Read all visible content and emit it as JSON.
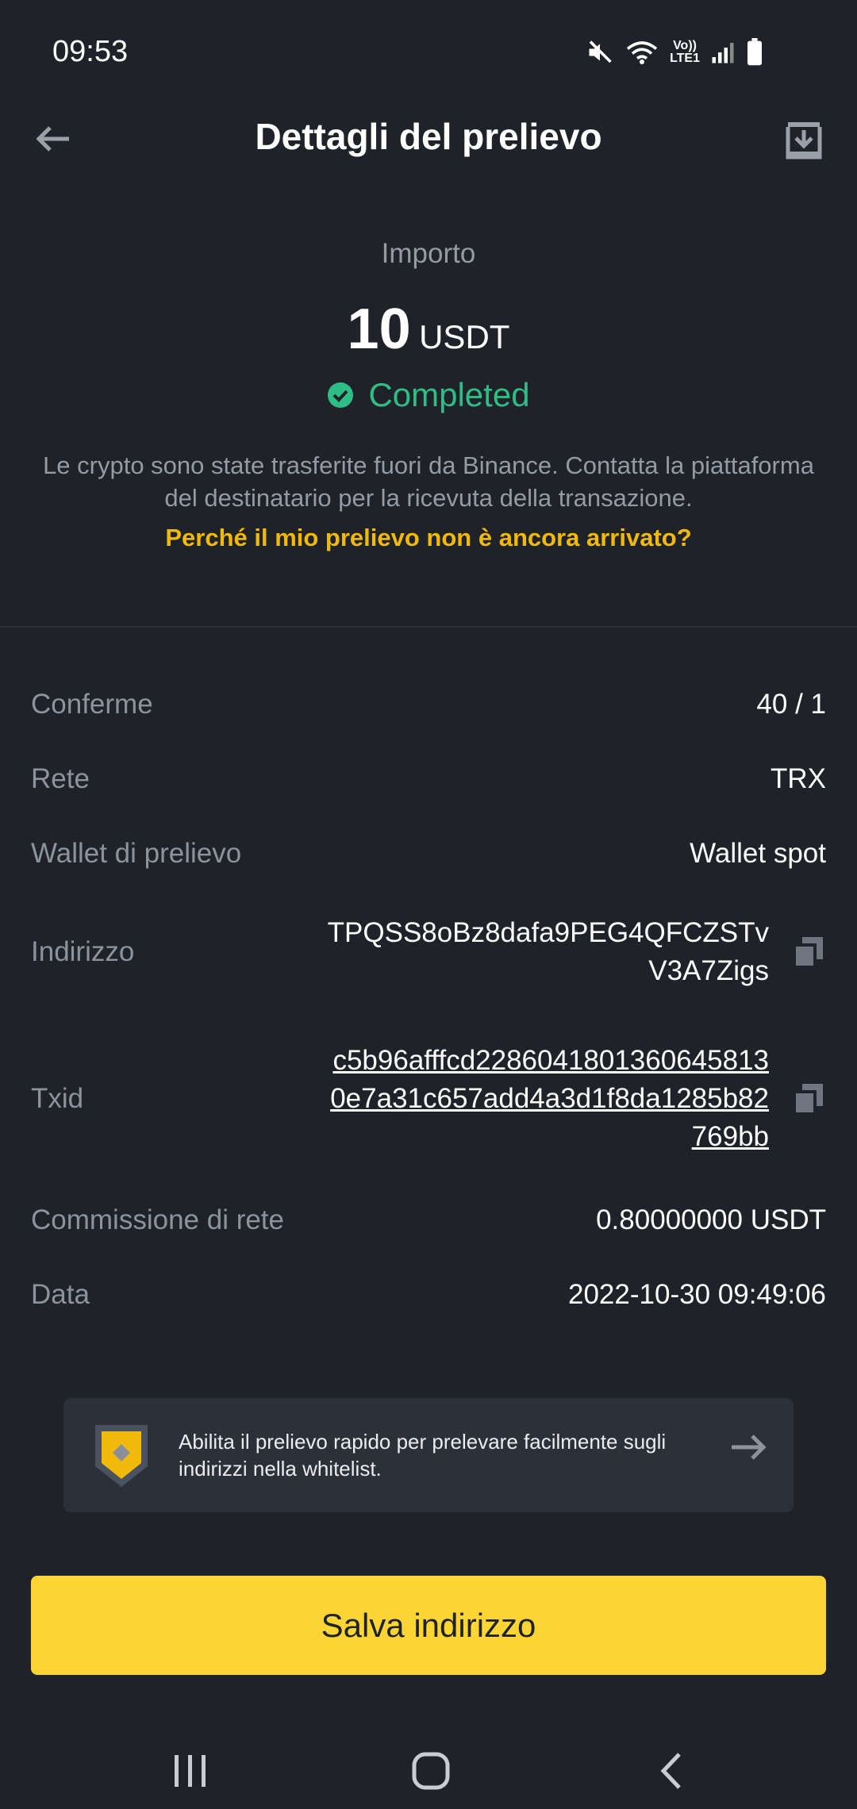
{
  "status_bar": {
    "time": "09:53",
    "lte_top": "Vo))",
    "lte_bottom": "LTE1"
  },
  "header": {
    "title": "Dettagli del prelievo"
  },
  "summary": {
    "amount_label": "Importo",
    "amount_value": "10",
    "amount_unit": "USDT",
    "status": "Completed",
    "description": "Le crypto sono state trasferite fuori da Binance. Contatta la piattaforma del destinatario per la ricevuta della transazione.",
    "help_link": "Perché il mio prelievo non è ancora arrivato?"
  },
  "details": {
    "confirmations": {
      "label": "Conferme",
      "value": "40 / 1"
    },
    "network": {
      "label": "Rete",
      "value": "TRX"
    },
    "wallet": {
      "label": "Wallet di prelievo",
      "value": "Wallet spot"
    },
    "address": {
      "label": "Indirizzo",
      "value": "TPQSS8oBz8dafa9PEG4QFCZSTvV3A7Zigs"
    },
    "txid": {
      "label": "Txid",
      "value": "c5b96afffcd22860418013606458130e7a31c657add4a3d1f8da1285b82769bb"
    },
    "fee": {
      "label": "Commissione di rete",
      "value": "0.80000000 USDT"
    },
    "date": {
      "label": "Data",
      "value": "2022-10-30 09:49:06"
    }
  },
  "promo": {
    "text": "Abilita il prelievo rapido per prelevare facilmente sugli indirizzi nella whitelist."
  },
  "actions": {
    "save_label": "Salva indirizzo"
  },
  "colors": {
    "accent": "#fcd535",
    "success": "#2ebd85",
    "link": "#f0b90b",
    "background": "#1f2329"
  },
  "icons": [
    "back-arrow-icon",
    "download-icon",
    "check-circle-icon",
    "copy-icon",
    "shield-icon",
    "arrow-right-icon",
    "mute-icon",
    "wifi-icon",
    "signal-icon",
    "battery-icon",
    "recents-icon",
    "home-icon",
    "back-nav-icon"
  ]
}
